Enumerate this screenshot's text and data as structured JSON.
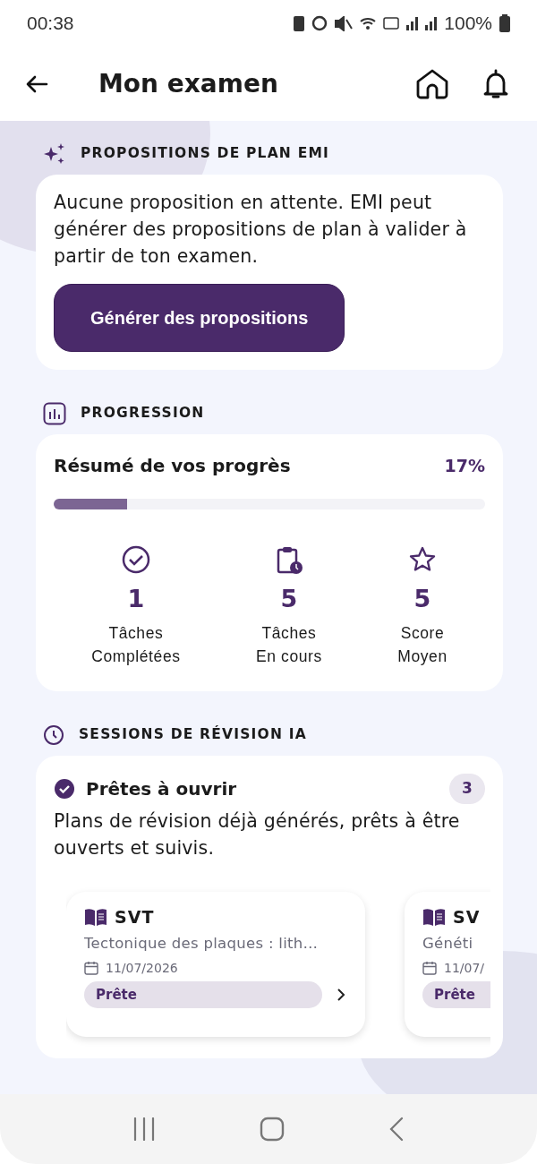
{
  "status_bar": {
    "time": "00:38",
    "battery": "100%"
  },
  "app_bar": {
    "title": "Mon examen"
  },
  "proposals": {
    "heading": "PROPOSITIONS DE PLAN EMI",
    "message": "Aucune proposition en attente. EMI peut générer des propositions de plan à valider à partir de ton examen.",
    "button": "Générer des propositions"
  },
  "progress": {
    "heading": "PROGRESSION",
    "title": "Résumé de vos progrès",
    "percent": "17%",
    "level": 0.17,
    "stats": [
      {
        "value": "1",
        "label_lines": [
          "Tâches",
          "Complétées"
        ]
      },
      {
        "value": "5",
        "label_lines": [
          "Tâches",
          "En cours"
        ]
      },
      {
        "value": "5",
        "label_lines": [
          "Score",
          "Moyen"
        ]
      }
    ]
  },
  "sessions": {
    "heading": "SESSIONS DE RÉVISION IA",
    "group_title": "Prêtes à ouvrir",
    "count": "3",
    "description": "Plans de révision déjà générés, prêts à être ouverts et suivis.",
    "cards": [
      {
        "subject": "SVT",
        "topic": "Tectonique des plaques : lith…",
        "date": "11/07/2026",
        "status": "Prête",
        "arrow": true
      },
      {
        "subject": "SV",
        "topic": "Généti",
        "date": "11/07/",
        "status": "Prête"
      }
    ]
  }
}
